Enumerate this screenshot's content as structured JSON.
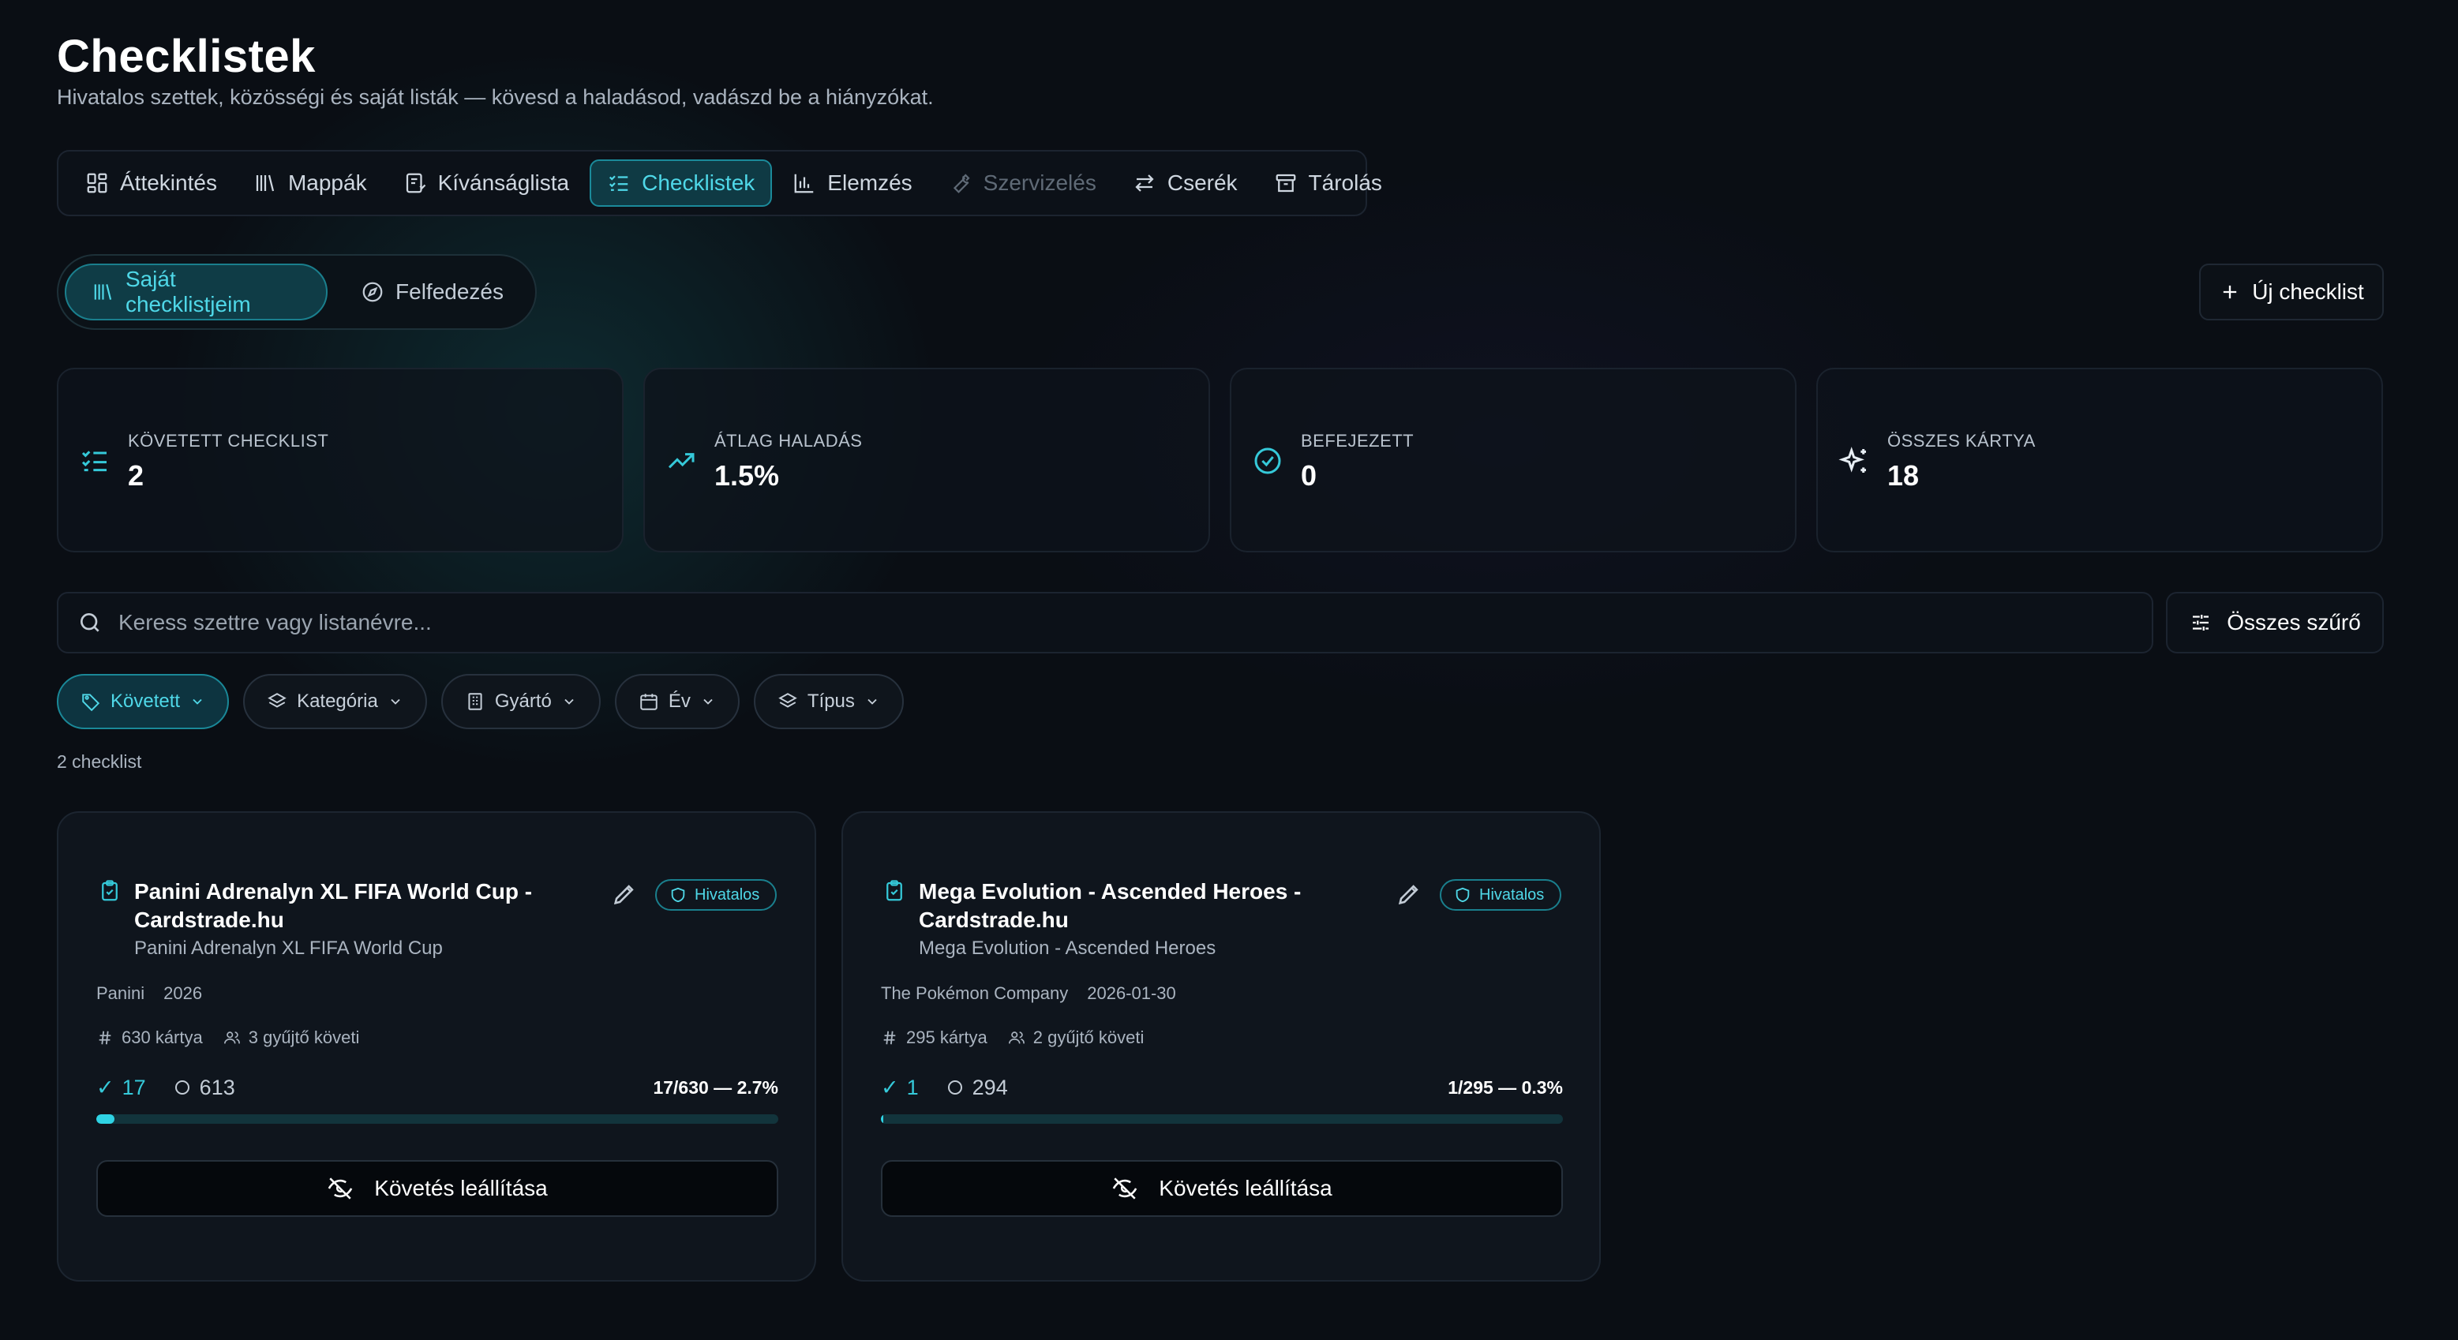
{
  "header": {
    "title": "Checklistek",
    "subtitle": "Hivatalos szettek, közösségi és saját listák — kövesd a haladásod, vadászd be a hiányzókat."
  },
  "tabs": [
    {
      "label": "Áttekintés",
      "icon": "dashboard-icon",
      "state": "normal"
    },
    {
      "label": "Mappák",
      "icon": "library-icon",
      "state": "normal"
    },
    {
      "label": "Kívánságlista",
      "icon": "wishlist-icon",
      "state": "normal"
    },
    {
      "label": "Checklistek",
      "icon": "checklist-icon",
      "state": "active"
    },
    {
      "label": "Elemzés",
      "icon": "bar-chart-icon",
      "state": "normal"
    },
    {
      "label": "Szervizelés",
      "icon": "wrench-icon",
      "state": "disabled"
    },
    {
      "label": "Cserék",
      "icon": "swap-icon",
      "state": "normal"
    },
    {
      "label": "Tárolás",
      "icon": "archive-icon",
      "state": "normal"
    }
  ],
  "segment": {
    "mine": "Saját checklistjeim",
    "discover": "Felfedezés"
  },
  "new_button": "Új checklist",
  "stats": [
    {
      "label": "KÖVETETT CHECKLIST",
      "value": "2",
      "icon": "list-check-icon"
    },
    {
      "label": "ÁTLAG HALADÁS",
      "value": "1.5%",
      "icon": "trending-up-icon"
    },
    {
      "label": "BEFEJEZETT",
      "value": "0",
      "icon": "check-circle-icon"
    },
    {
      "label": "ÖSSZES KÁRTYA",
      "value": "18",
      "icon": "sparkles-icon"
    }
  ],
  "search": {
    "placeholder": "Keress szettre vagy listanévre...",
    "value": ""
  },
  "filter_all": "Összes szűrő",
  "chips": [
    {
      "label": "Követett",
      "icon": "tag-icon",
      "active": true
    },
    {
      "label": "Kategória",
      "icon": "layers-icon",
      "active": false
    },
    {
      "label": "Gyártó",
      "icon": "building-icon",
      "active": false
    },
    {
      "label": "Év",
      "icon": "calendar-icon",
      "active": false
    },
    {
      "label": "Típus",
      "icon": "layers-icon",
      "active": false
    }
  ],
  "count_text": "2 checklist",
  "cards": [
    {
      "title": "Panini Adrenalyn XL FIFA World Cup - Cardstrade.hu",
      "subtitle": "Panini Adrenalyn XL FIFA World Cup",
      "badge": "Hivatalos",
      "publisher": "Panini",
      "date": "2026",
      "cards_count": "630 kártya",
      "followers": "3 gyűjtő követi",
      "owned": "17",
      "missing": "613",
      "progress_text": "17/630 — 2.7%",
      "progress": 0.027,
      "stop_label": "Követés leállítása"
    },
    {
      "title": "Mega Evolution - Ascended Heroes - Cardstrade.hu",
      "subtitle": "Mega Evolution - Ascended Heroes",
      "badge": "Hivatalos",
      "publisher": "The Pokémon Company",
      "date": "2026-01-30",
      "cards_count": "295 kártya",
      "followers": "2 gyűjtő követi",
      "owned": "1",
      "missing": "294",
      "progress_text": "1/295 — 0.3%",
      "progress": 0.003,
      "stop_label": "Követés leállítása"
    }
  ],
  "colors": {
    "accent": "#2fd3e4",
    "background": "#0a0e14",
    "card": "#0f151d"
  }
}
